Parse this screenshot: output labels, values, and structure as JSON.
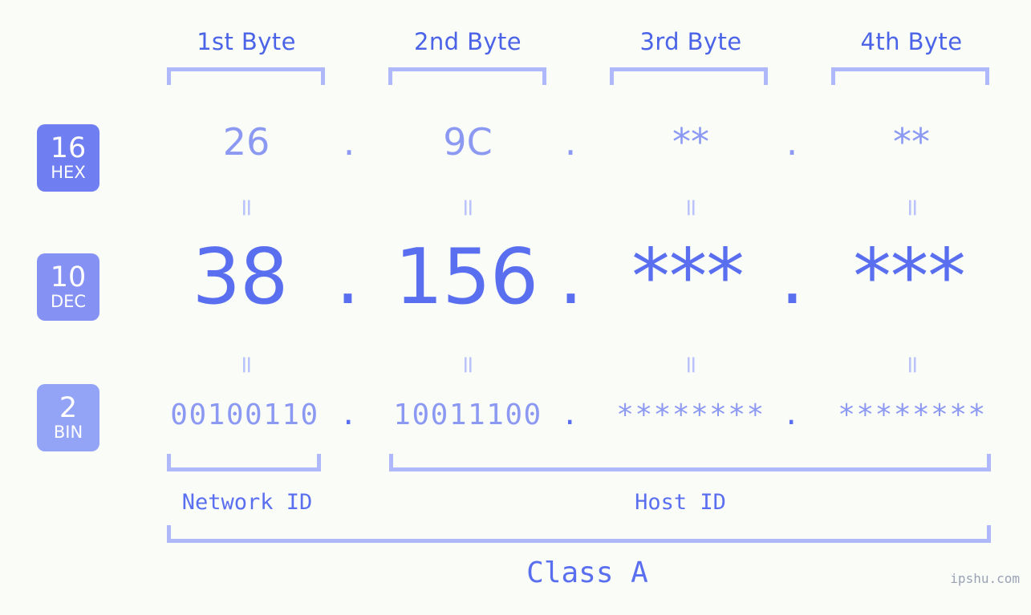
{
  "meta": {
    "watermark": "ipshu.com",
    "background_color": "#fafcf8",
    "accent_strong": "#5a6ff0",
    "accent_mid": "#8c99f2",
    "accent_light": "#aeb8fb",
    "badge_hex_color": "#6f7ef0",
    "badge_dec_color": "#8692f3",
    "badge_bin_color": "#93a4f7"
  },
  "headers": {
    "bytes": [
      {
        "label": "1st Byte"
      },
      {
        "label": "2nd Byte"
      },
      {
        "label": "3rd Byte"
      },
      {
        "label": "4th Byte"
      }
    ]
  },
  "bases": {
    "hex": {
      "number": "16",
      "name": "HEX"
    },
    "dec": {
      "number": "10",
      "name": "DEC"
    },
    "bin": {
      "number": "2",
      "name": "BIN"
    }
  },
  "rows": {
    "hex": {
      "values": [
        "26",
        "9C",
        "**",
        "**"
      ],
      "separators": [
        ".",
        ".",
        "."
      ]
    },
    "dec": {
      "values": [
        "38",
        "156",
        "***",
        "***"
      ],
      "separators": [
        ".",
        ".",
        "."
      ]
    },
    "bin": {
      "values": [
        "00100110",
        "10011100",
        "********",
        "********"
      ],
      "separators": [
        ".",
        ".",
        "."
      ]
    }
  },
  "connectors": {
    "symbol": "=",
    "rows": 2,
    "columns": 4
  },
  "segments": {
    "network_id": "Network ID",
    "host_id": "Host ID",
    "class": "Class A"
  }
}
